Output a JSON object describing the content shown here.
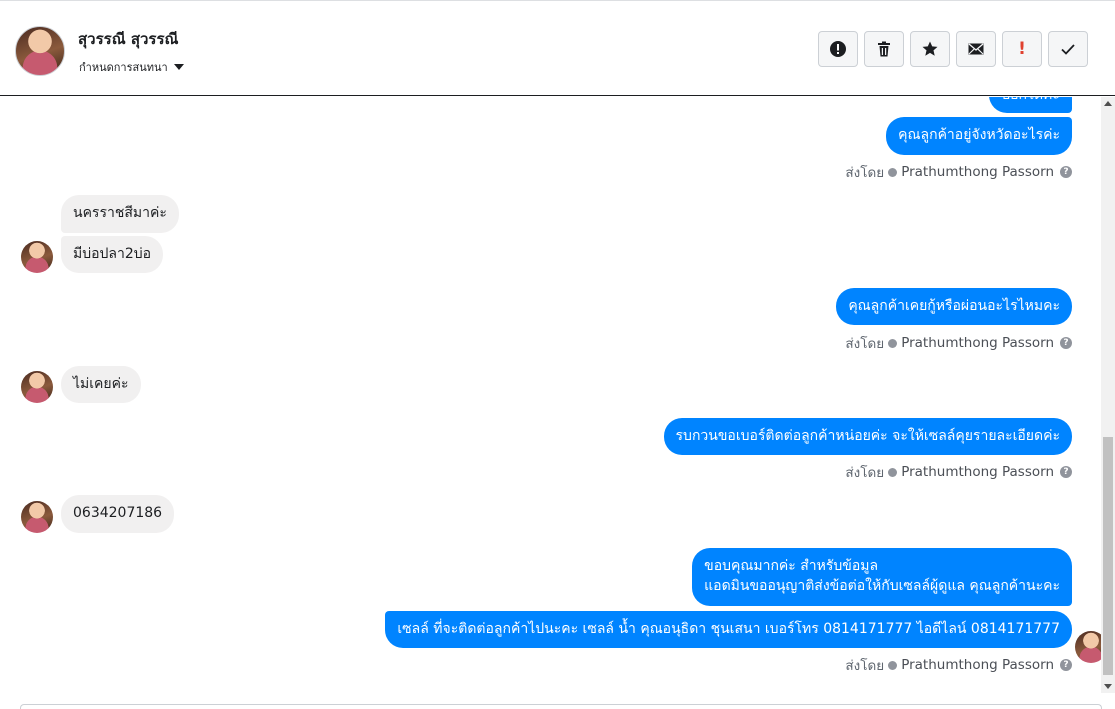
{
  "header": {
    "contact_name": "สุวรรณี สุวรรณี",
    "conversation_menu_label": "กำหนดการสนทนา",
    "toolbar": [
      {
        "name": "mark-spam-button",
        "icon": "alert-circle-icon"
      },
      {
        "name": "delete-button",
        "icon": "trash-icon"
      },
      {
        "name": "star-button",
        "icon": "star-icon"
      },
      {
        "name": "mark-unread-button",
        "icon": "envelope-icon"
      },
      {
        "name": "follow-up-button",
        "icon": "exclamation-icon",
        "text": "!"
      },
      {
        "name": "mark-done-button",
        "icon": "checkmark-icon"
      }
    ]
  },
  "messages": {
    "out_partial": "บอกได้ค่ะ",
    "out_1": "คุณลูกค้าอยู่จังหวัดอะไรค่ะ",
    "sent_by_1": {
      "label": "ส่งโดย",
      "sender": "Prathumthong Passorn"
    },
    "in_1": "นครราชสีมาค่ะ",
    "in_2": "มีบ่อปลา2บ่อ",
    "out_2": "คุณลูกค้าเคยกู้หรือผ่อนอะไรไหมคะ",
    "sent_by_2": {
      "label": "ส่งโดย",
      "sender": "Prathumthong Passorn"
    },
    "in_3": "ไม่เคยค่ะ",
    "out_3": "รบกวนขอเบอร์ติดต่อลูกค้าหน่อยค่ะ จะให้เซลล์คุยรายละเอียดค่ะ",
    "sent_by_3": {
      "label": "ส่งโดย",
      "sender": "Prathumthong Passorn"
    },
    "in_4": "0634207186",
    "out_4_line1": "ขอบคุณมากค่ะ สำหรับข้อมูล",
    "out_4_line2": "แอดมินขออนุญาติส่งข้อต่อให้กับเซลล์ผู้ดูแล คุณลูกค้านะคะ",
    "out_5": "เซลล์ ที่จะติดต่อลูกค้าไปนะคะ เซลล์ น้ำ คุณอนุธิดา ชุนเสนา เบอร์โทร 0814171777 ไอดีไลน์ 0814171777",
    "sent_by_4": {
      "label": "ส่งโดย",
      "sender": "Prathumthong Passorn"
    },
    "help_glyph": "?"
  },
  "colors": {
    "outgoing_bubble": "#0084ff",
    "incoming_bubble": "#f1f0f0",
    "follow_up_icon": "#e0412f"
  }
}
